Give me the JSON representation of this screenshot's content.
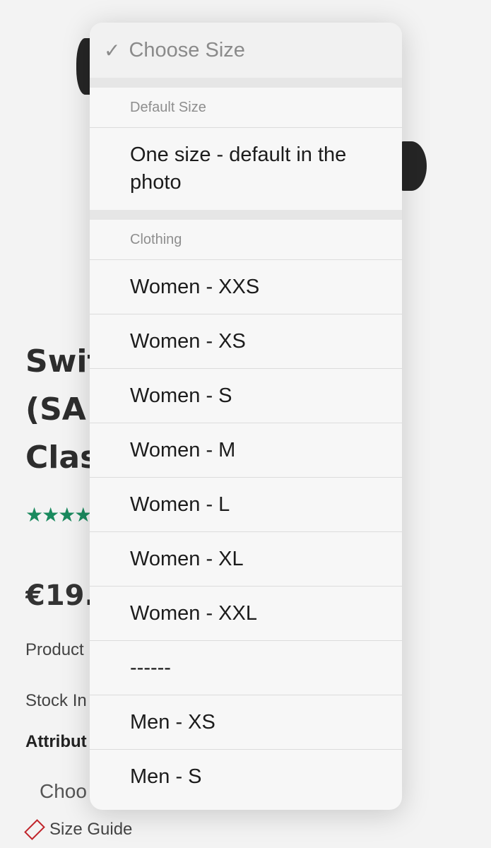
{
  "page": {
    "title": "Swit\n(SA\nClas",
    "rating_stars": "★★★★",
    "price": "€19.0",
    "product_label": "Product",
    "stock_label": "Stock  In",
    "attributes_label": "Attribut",
    "select_value": "Choo",
    "size_guide": "Size Guide"
  },
  "picker": {
    "selected": "Choose Size",
    "groups": [
      {
        "label": "Default Size",
        "options": [
          "One size - default in the photo"
        ]
      },
      {
        "label": "Clothing",
        "options": [
          "Women - XXS",
          "Women - XS",
          "Women - S",
          "Women - M",
          "Women - L",
          "Women - XL",
          "Women - XXL",
          "------",
          "Men - XS",
          "Men - S"
        ]
      }
    ]
  }
}
